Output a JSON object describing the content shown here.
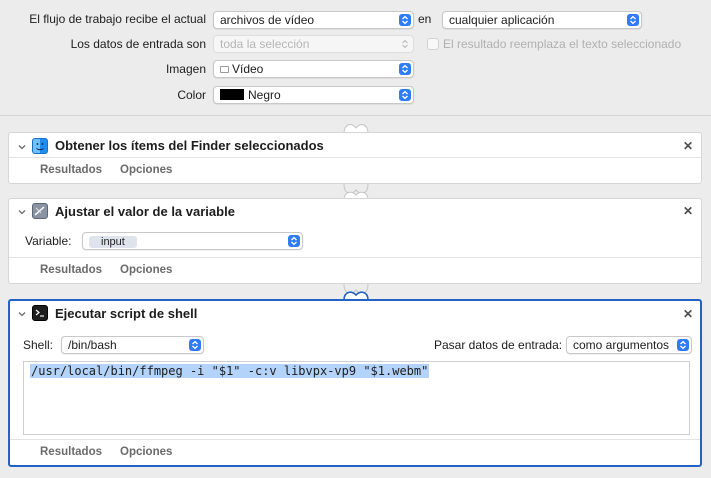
{
  "header": {
    "workflow_label": "El flujo de trabajo recibe el actual",
    "workflow_value": "archivos de vídeo",
    "in_label": "en",
    "app_value": "cualquier aplicación",
    "input_label": "Los datos de entrada son",
    "input_value": "toda la selección",
    "replace_label": "El resultado reemplaza el texto seleccionado",
    "image_label": "Imagen",
    "image_value": "Vídeo",
    "image_icon": "film-icon",
    "color_label": "Color",
    "color_value": "Negro",
    "color_swatch": "#000000"
  },
  "panels": [
    {
      "title": "Obtener los ítems del Finder seleccionados",
      "icon": "finder-icon",
      "tabs": [
        "Resultados",
        "Opciones"
      ]
    },
    {
      "title": "Ajustar el valor de la variable",
      "icon": "variable-icon",
      "variable_label": "Variable:",
      "variable_value": "input",
      "tabs": [
        "Resultados",
        "Opciones"
      ]
    },
    {
      "title": "Ejecutar script de shell",
      "icon": "terminal-icon",
      "shell_label": "Shell:",
      "shell_value": "/bin/bash",
      "pass_label": "Pasar datos de entrada:",
      "pass_value": "como argumentos",
      "script": "/usr/local/bin/ffmpeg -i \"$1\" -c:v libvpx-vp9 \"$1.webm\"",
      "tabs": [
        "Resultados",
        "Opciones"
      ]
    }
  ],
  "colors": {
    "accent": "#2f7cf6",
    "selection_border": "#2263c5",
    "code_highlight": "#b3d3fb"
  }
}
